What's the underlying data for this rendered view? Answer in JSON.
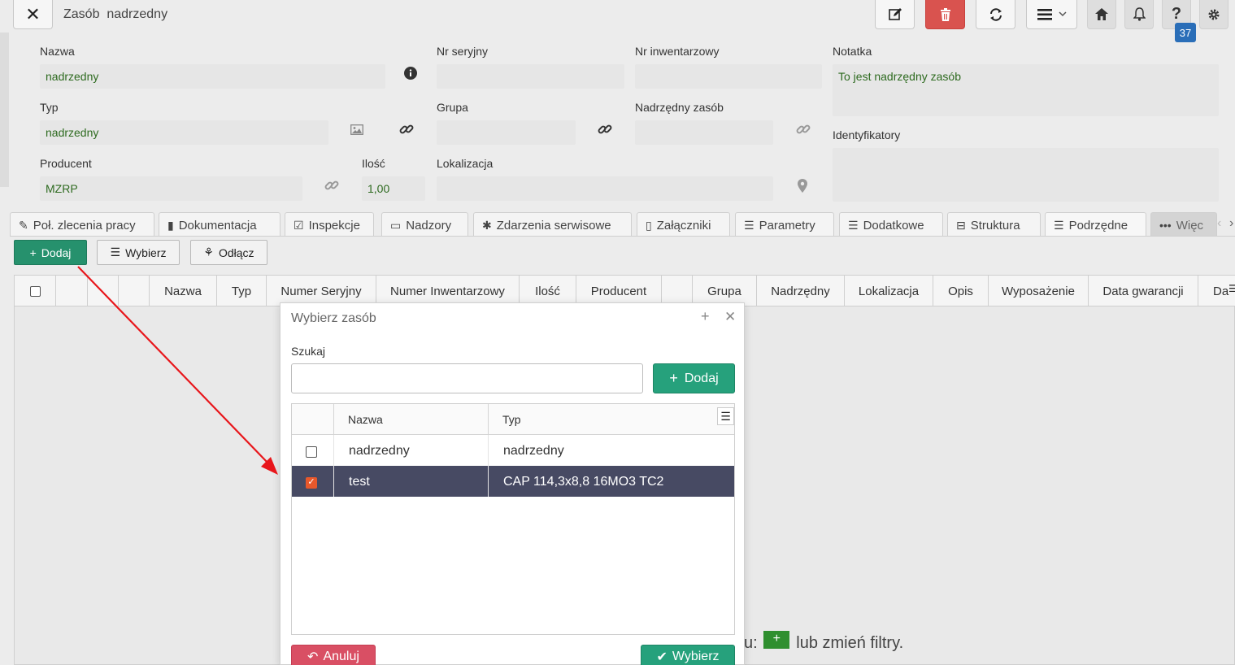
{
  "header": {
    "close_icon": "close-icon",
    "title": "Zasób  nadrzedny",
    "badge_count": "37",
    "buttons": [
      "edit-icon",
      "trash-icon",
      "refresh-icon",
      "menu-icon",
      "home-icon",
      "bell-icon",
      "help-icon",
      "gear-icon"
    ]
  },
  "form": {
    "nazwa_label": "Nazwa",
    "nazwa_value": "nadrzedny",
    "nr_seryjny_label": "Nr seryjny",
    "nr_seryjny_value": "",
    "nr_inwentarzowy_label": "Nr inwentarzowy",
    "nr_inwentarzowy_value": "",
    "notatka_label": "Notatka",
    "notatka_value": "To jest nadrzędny zasób",
    "typ_label": "Typ",
    "typ_value": "nadrzedny",
    "grupa_label": "Grupa",
    "grupa_value": "",
    "nadrzedny_label": "Nadrzędny zasób",
    "nadrzedny_value": "",
    "identyfikatory_label": "Identyfikatory",
    "identyfikatory_value": "",
    "producent_label": "Producent",
    "producent_value": "MZRP",
    "ilosc_label": "Ilość",
    "ilosc_value": "1,00",
    "lokalizacja_label": "Lokalizacja",
    "lokalizacja_value": ""
  },
  "tabs": [
    {
      "label": "Poł. zlecenia pracy",
      "icon": "wrench-icon"
    },
    {
      "label": "Dokumentacja",
      "icon": "bookmark-icon"
    },
    {
      "label": "Inspekcje",
      "icon": "checkbox-icon"
    },
    {
      "label": "Nadzory",
      "icon": "minus-box-icon"
    },
    {
      "label": "Zdarzenia serwisowe",
      "icon": "bug-icon"
    },
    {
      "label": "Załączniki",
      "icon": "file-icon"
    },
    {
      "label": "Parametry",
      "icon": "list-icon"
    },
    {
      "label": "Dodatkowe",
      "icon": "list-icon"
    },
    {
      "label": "Struktura",
      "icon": "tree-icon"
    },
    {
      "label": "Podrzędne",
      "icon": "list-icon"
    },
    {
      "label": "Więc",
      "icon": "dots-icon"
    }
  ],
  "actions": {
    "add": "Dodaj",
    "choose": "Wybierz",
    "detach": "Odłącz"
  },
  "grid": {
    "columns": [
      "Nazwa",
      "Typ",
      "Numer Seryjny",
      "Numer Inwentarzowy",
      "Ilość",
      "Producent",
      "",
      "Grupa",
      "Nadrzędny",
      "Lokalizacja",
      "Opis",
      "Wyposażenie",
      "Data gwarancji",
      "Da"
    ],
    "empty_suffix_pre": "u:",
    "empty_suffix_post": "lub zmień filtry."
  },
  "modal": {
    "title": "Wybierz zasób",
    "search_label": "Szukaj",
    "search_value": "",
    "add_label": "Dodaj",
    "col_name": "Nazwa",
    "col_type": "Typ",
    "rows": [
      {
        "name": "nadrzedny",
        "type": "nadrzedny",
        "checked": false
      },
      {
        "name": "test",
        "type": "CAP 114,3x8,8 16MO3 TC2",
        "checked": true
      }
    ],
    "cancel_label": "Anuluj",
    "choose_label": "Wybierz"
  },
  "colors": {
    "accent_green": "#26a17c",
    "danger": "#d9534f",
    "selected_row": "#474a63",
    "checkbox_on": "#e8582b",
    "field_text": "#2d6a1f",
    "annotation_arrow": "#e8161b"
  }
}
